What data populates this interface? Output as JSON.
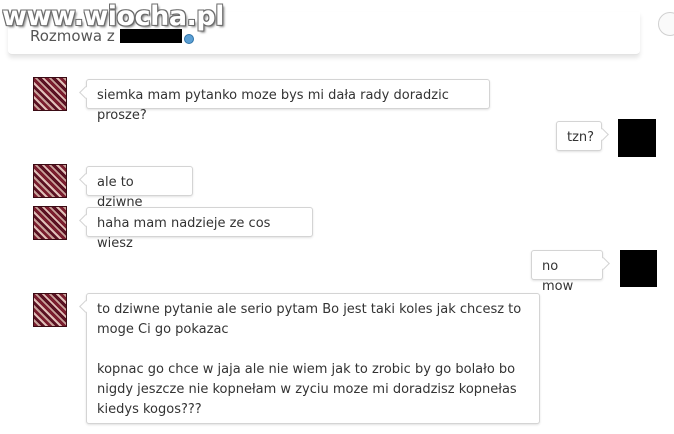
{
  "watermark": "www.wiocha.pl",
  "header": {
    "title": "Rozmowa z"
  },
  "icons": {
    "status": "online-status-dot-icon",
    "corner": "circle-icon"
  },
  "messages": [
    {
      "sender": "other",
      "text": "siemka mam pytanko moze bys mi dała rady doradzic prosze?"
    },
    {
      "sender": "self",
      "text": "tzn?"
    },
    {
      "sender": "other",
      "text": "ale to dziwne"
    },
    {
      "sender": "other",
      "text": "haha mam nadzieje ze cos wiesz"
    },
    {
      "sender": "self",
      "text": "no mow"
    },
    {
      "sender": "other",
      "paragraphs": [
        "to dziwne pytanie ale serio pytam Bo jest taki koles jak chcesz to moge Ci go pokazac",
        "kopnac go chce w jaja ale nie wiem jak to zrobic by go bolało bo nigdy jeszcze nie kopnełam w zyciu moze mi doradzisz kopnełas kiedys kogos???"
      ]
    }
  ],
  "colors": {
    "bubble_border": "#d4d4d4",
    "status_dot": "#5b9fd4"
  }
}
